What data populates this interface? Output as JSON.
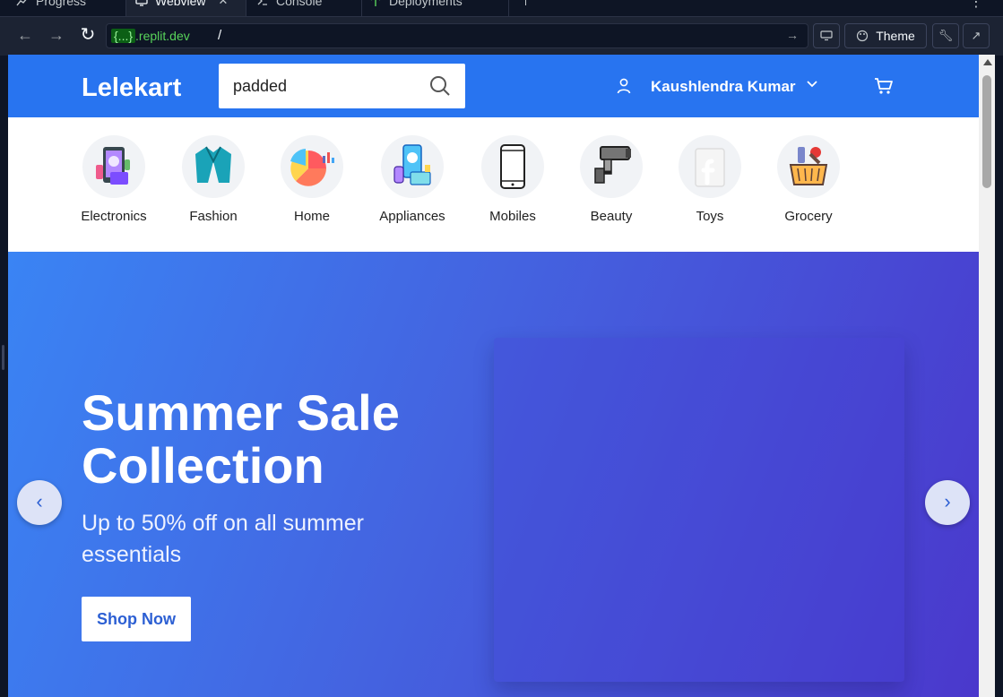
{
  "ide": {
    "tabs": [
      {
        "label": "Progress",
        "icon": "progress-icon"
      },
      {
        "label": "Webview",
        "icon": "monitor-icon",
        "active": true
      },
      {
        "label": "Console",
        "icon": "terminal-icon"
      },
      {
        "label": "Deployments",
        "icon": "deployments-icon"
      }
    ],
    "url": {
      "host_braces": "{...}",
      "host_suffix": ".replit.dev",
      "path": "/"
    },
    "theme_label": "Theme"
  },
  "site": {
    "logo": "Lelekart",
    "search": {
      "value": "padded"
    },
    "user": {
      "name": "Kaushlendra Kumar"
    },
    "categories": [
      {
        "label": "Electronics",
        "icon": "electronics-icon"
      },
      {
        "label": "Fashion",
        "icon": "jacket-icon"
      },
      {
        "label": "Home",
        "icon": "pie-chart-icon"
      },
      {
        "label": "Appliances",
        "icon": "appliances-icon"
      },
      {
        "label": "Mobiles",
        "icon": "smartphone-icon"
      },
      {
        "label": "Beauty",
        "icon": "beauty-icon"
      },
      {
        "label": "Toys",
        "icon": "toys-icon"
      },
      {
        "label": "Grocery",
        "icon": "grocery-basket-icon"
      }
    ],
    "hero": {
      "title": "Summer Sale Collection",
      "subtitle": "Up to 50% off on all summer essentials",
      "cta": "Shop Now",
      "prev_glyph": "‹",
      "next_glyph": "›"
    }
  },
  "colors": {
    "brand": "#2874f0",
    "hero_start": "#3a84f4",
    "hero_end": "#4a38cc",
    "ide_bg": "#0e1525",
    "url_host": "#58d35a"
  }
}
